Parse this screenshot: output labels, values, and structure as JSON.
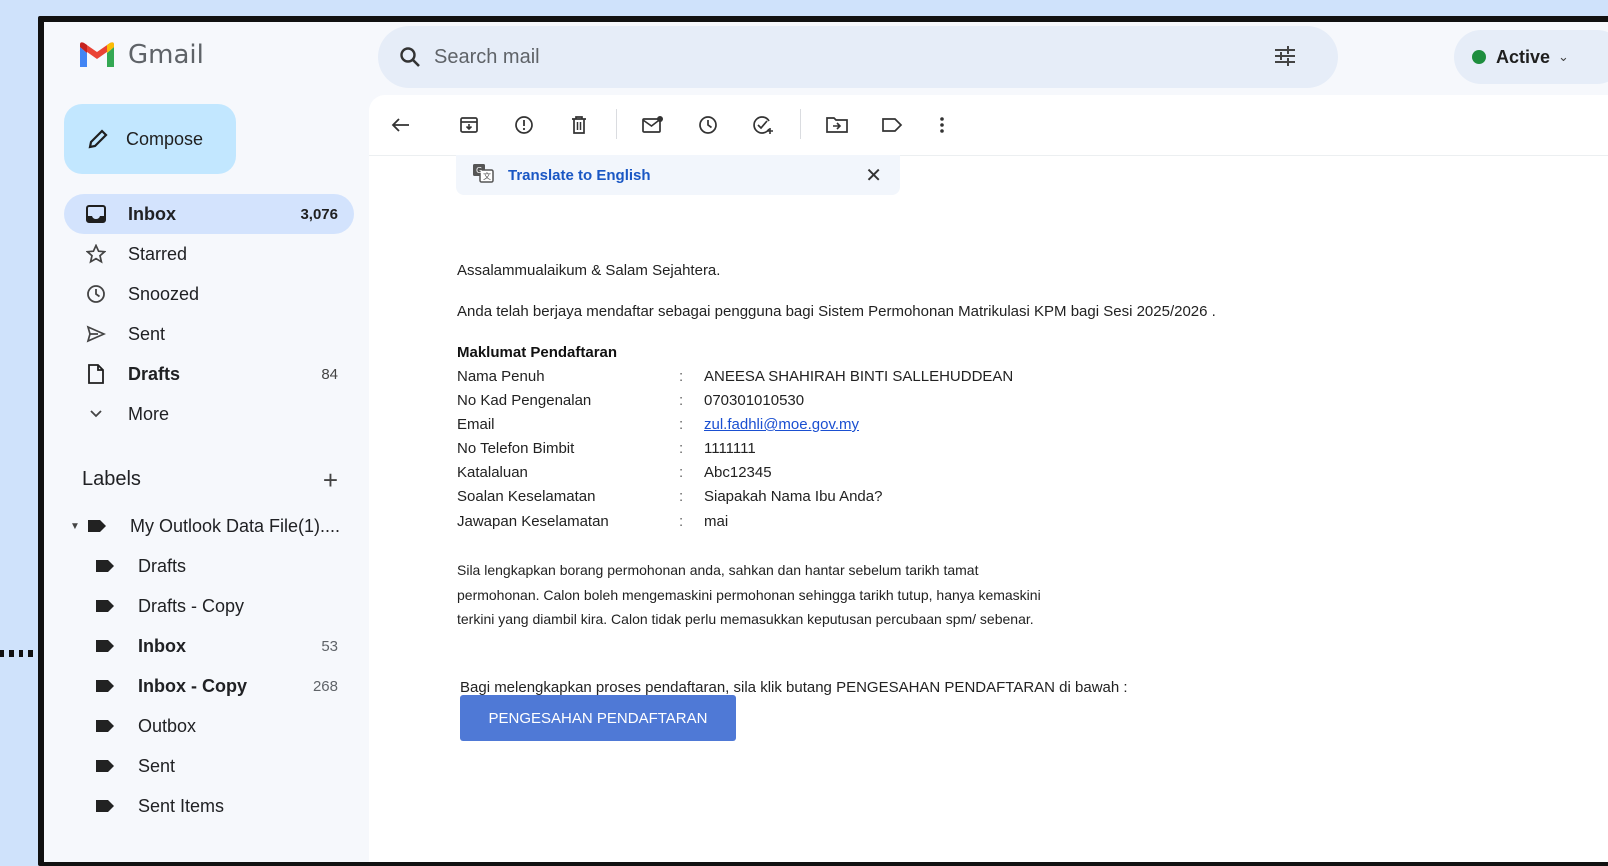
{
  "app": {
    "name": "Gmail"
  },
  "search": {
    "placeholder": "Search mail"
  },
  "status": {
    "label": "Active",
    "color": "#1e8e3e"
  },
  "compose": {
    "label": "Compose"
  },
  "nav": [
    {
      "label": "Inbox",
      "count": "3,076",
      "icon": "inbox-icon"
    },
    {
      "label": "Starred",
      "count": "",
      "icon": "star-icon"
    },
    {
      "label": "Snoozed",
      "count": "",
      "icon": "clock-icon"
    },
    {
      "label": "Sent",
      "count": "",
      "icon": "send-icon"
    },
    {
      "label": "Drafts",
      "count": "84",
      "icon": "draft-icon"
    },
    {
      "label": "More",
      "count": "",
      "icon": "chevron-down-icon"
    }
  ],
  "labels": {
    "title": "Labels",
    "items": [
      {
        "label": "My Outlook Data File(1)....",
        "count": ""
      },
      {
        "label": "Drafts",
        "count": ""
      },
      {
        "label": "Drafts - Copy",
        "count": ""
      },
      {
        "label": "Inbox",
        "count": "53"
      },
      {
        "label": "Inbox - Copy",
        "count": "268"
      },
      {
        "label": "Outbox",
        "count": ""
      },
      {
        "label": "Sent",
        "count": ""
      },
      {
        "label": "Sent Items",
        "count": ""
      }
    ]
  },
  "translate": {
    "label": "Translate to English"
  },
  "email": {
    "greeting": "Assalammualaikum & Salam Sejahtera.",
    "intro": "Anda telah berjaya mendaftar sebagai pengguna bagi Sistem Permohonan Matrikulasi KPM bagi Sesi 2025/2026 .",
    "section_title": "Maklumat Pendaftaran",
    "fields": [
      {
        "key": "Nama Penuh",
        "value": "ANEESA SHAHIRAH BINTI SALLEHUDDEAN"
      },
      {
        "key": "No Kad Pengenalan",
        "value": "070301010530"
      },
      {
        "key": "Email",
        "value": "zul.fadhli@moe.gov.my"
      },
      {
        "key": "No Telefon Bimbit",
        "value": "1111111"
      },
      {
        "key": "Katalaluan",
        "value": "Abc12345"
      },
      {
        "key": "Soalan Keselamatan",
        "value": "Siapakah Nama Ibu Anda?"
      },
      {
        "key": "Jawapan Keselamatan",
        "value": "mai"
      }
    ],
    "colon": ":",
    "para_lines": [
      "Sila lengkapkan borang permohonan anda, sahkan dan hantar sebelum tarikh tamat",
      "permohonan. Calon boleh mengemaskini permohonan sehingga tarikh tutup, hanya kemaskini",
      "terkini yang diambil kira. Calon tidak perlu memasukkan keputusan percubaan spm/ sebenar."
    ],
    "instruction": "Bagi melengkapkan proses pendaftaran, sila klik butang PENGESAHAN PENDAFTARAN di bawah :",
    "button_label": "PENGESAHAN PENDAFTARAN"
  }
}
